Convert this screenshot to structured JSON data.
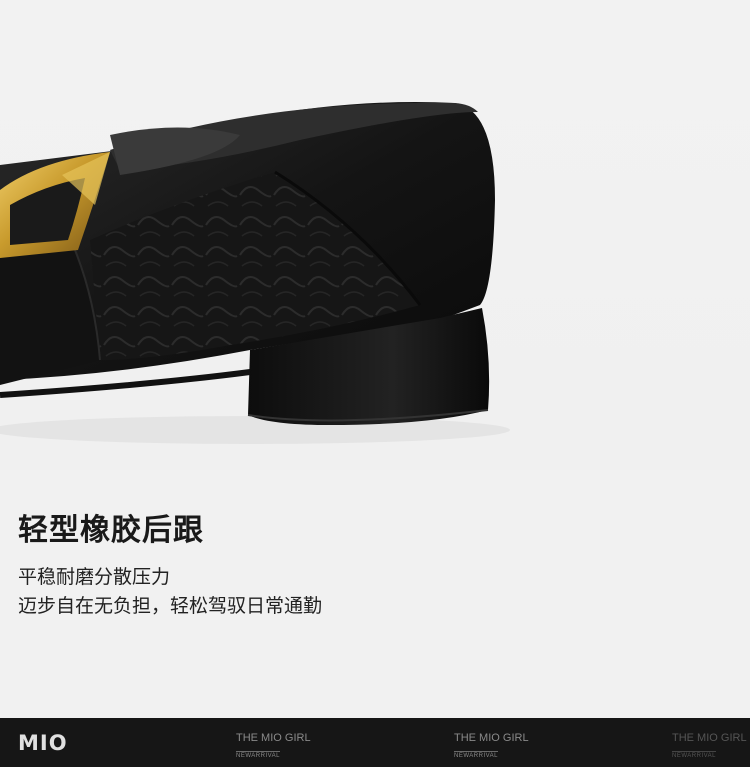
{
  "headline": "轻型橡胶后跟",
  "description": {
    "line1": "平稳耐磨分散压力",
    "line2": "迈步自在无负担，轻松驾驭日常通勤"
  },
  "footer": {
    "logo": "MIO",
    "tags": [
      {
        "title": "THE MIO GIRL",
        "subtitle": "NEWARRIVAL"
      },
      {
        "title": "THE MIO GIRL",
        "subtitle": "NEWARRIVAL"
      },
      {
        "title": "THE MIO GIRL",
        "subtitle": "NEWARRIVAL"
      }
    ]
  },
  "colors": {
    "background": "#f1f1f1",
    "footer": "#161616",
    "buckle": "#c9a13a",
    "leather": "#1b1b1b"
  }
}
